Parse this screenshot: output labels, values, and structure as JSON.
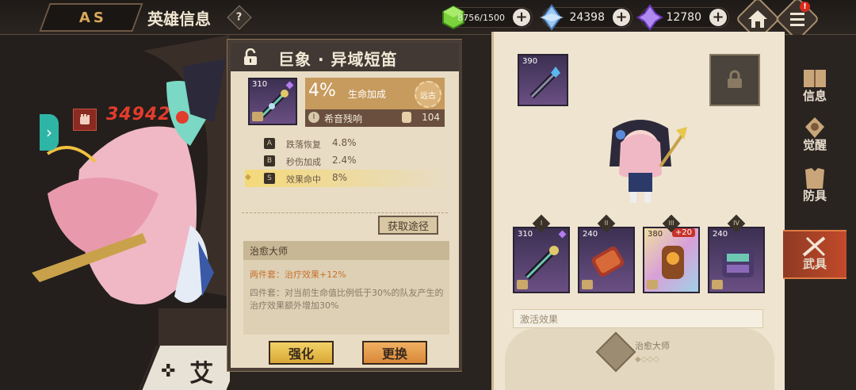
{
  "header": {
    "title": "英雄信息",
    "help_label": "?"
  },
  "resources": [
    {
      "name": "stamina",
      "icon": "green-cube-icon",
      "value": "8756/1500"
    },
    {
      "name": "crystal",
      "icon": "blue-crystal-icon",
      "value": "24398"
    },
    {
      "name": "premium",
      "icon": "purple-crystal-icon",
      "value": "12780"
    }
  ],
  "notification_badge": "!",
  "hero": {
    "power": "34942",
    "name": "艾"
  },
  "weapon": {
    "title": "巨象 · 异域短笛",
    "level": "310",
    "main_stat_value": "4%",
    "main_stat_label": "生命加成",
    "badge_label": "远古",
    "sub_roman": "I",
    "sub_label": "希音残响",
    "sub_value": "104",
    "substats": [
      {
        "grade": "A",
        "name": "跌落恢复",
        "value": "4.8%",
        "highlight": false
      },
      {
        "grade": "B",
        "name": "秒伤加成",
        "value": "2.4%",
        "highlight": false
      },
      {
        "grade": "S",
        "name": "效果命中",
        "value": "8%",
        "highlight": true
      }
    ],
    "acquire_label": "获取途径",
    "set": {
      "name": "治愈大师",
      "two_piece": "两件套：治疗效果+12%",
      "four_piece": "四件套：对当前生命值比例低于30%的队友产生的治疗效果额外增加30%"
    },
    "enhance_label": "强化",
    "swap_label": "更换"
  },
  "equipment": {
    "main_slot_level": "390",
    "slots": [
      {
        "roman": "I",
        "level": "310",
        "bonus": ""
      },
      {
        "roman": "II",
        "level": "240",
        "bonus": ""
      },
      {
        "roman": "III",
        "level": "380",
        "bonus": "+20"
      },
      {
        "roman": "IV",
        "level": "240",
        "bonus": ""
      }
    ],
    "activate_label": "激活效果",
    "set_label": "治愈大师",
    "set_dots": "◆◇◇◇"
  },
  "nav": [
    {
      "label": "信息",
      "icon": "book-icon",
      "active": false
    },
    {
      "label": "觉醒",
      "icon": "emblem-icon",
      "active": false
    },
    {
      "label": "防具",
      "icon": "armor-icon",
      "active": false
    },
    {
      "label": "武具",
      "icon": "weapon-icon",
      "active": true
    }
  ]
}
